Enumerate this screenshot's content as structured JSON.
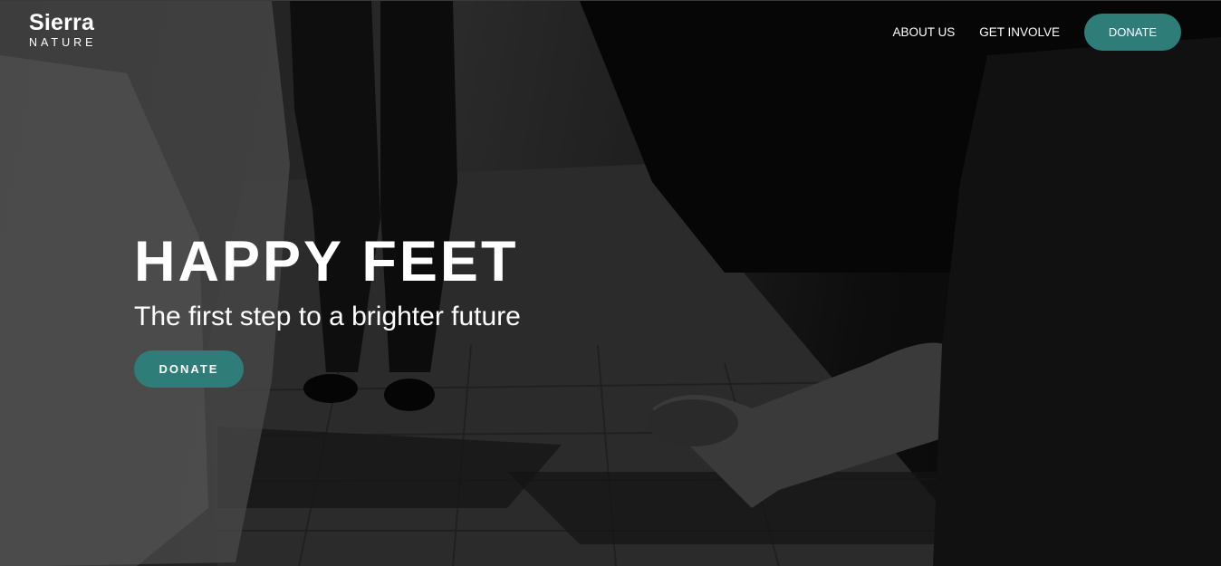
{
  "brand": {
    "name": "Sierra",
    "tagline": "NATURE"
  },
  "nav": {
    "links": [
      {
        "label": "ABOUT US"
      },
      {
        "label": "GET INVOLVE"
      }
    ],
    "donate_label": "DONATE"
  },
  "hero": {
    "headline": "HAPPY FEET",
    "subheadline": "The first step to a brighter future",
    "cta_label": "DONATE",
    "background_image": "black-and-white street photo of people walking on a tiled sidewalk"
  },
  "colors": {
    "accent": "#2e7d78",
    "text": "#ffffff",
    "background": "#0b0b0b"
  }
}
